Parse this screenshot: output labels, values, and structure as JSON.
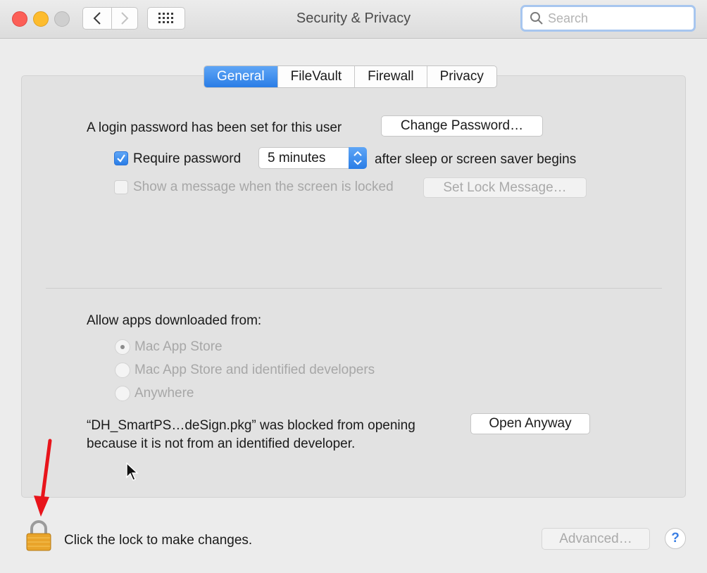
{
  "window": {
    "title": "Security & Privacy",
    "search_placeholder": "Search"
  },
  "tabs": [
    {
      "label": "General",
      "active": true
    },
    {
      "label": "FileVault",
      "active": false
    },
    {
      "label": "Firewall",
      "active": false
    },
    {
      "label": "Privacy",
      "active": false
    }
  ],
  "general": {
    "login_password_text": "A login password has been set for this user",
    "change_password_label": "Change Password…",
    "require_password_label": "Require password",
    "require_password_checked": true,
    "require_password_delay": "5 minutes",
    "after_sleep_text": "after sleep or screen saver begins",
    "show_message_label": "Show a message when the screen is locked",
    "show_message_checked": false,
    "set_lock_message_label": "Set Lock Message…",
    "allow_apps_label": "Allow apps downloaded from:",
    "radio_options": [
      {
        "label": "Mac App Store",
        "selected": true
      },
      {
        "label": "Mac App Store and identified developers",
        "selected": false
      },
      {
        "label": "Anywhere",
        "selected": false
      }
    ],
    "blocked_line1": "“DH_SmartPS…deSign.pkg” was blocked from opening",
    "blocked_line2": "because it is not from an identified developer.",
    "open_anyway_label": "Open Anyway"
  },
  "footer": {
    "lock_text": "Click the lock to make changes.",
    "advanced_label": "Advanced…",
    "help_label": "?"
  },
  "colors": {
    "accent": "#2a7de6",
    "annotation_arrow": "#e8141b",
    "lock": "#e9a42a"
  }
}
